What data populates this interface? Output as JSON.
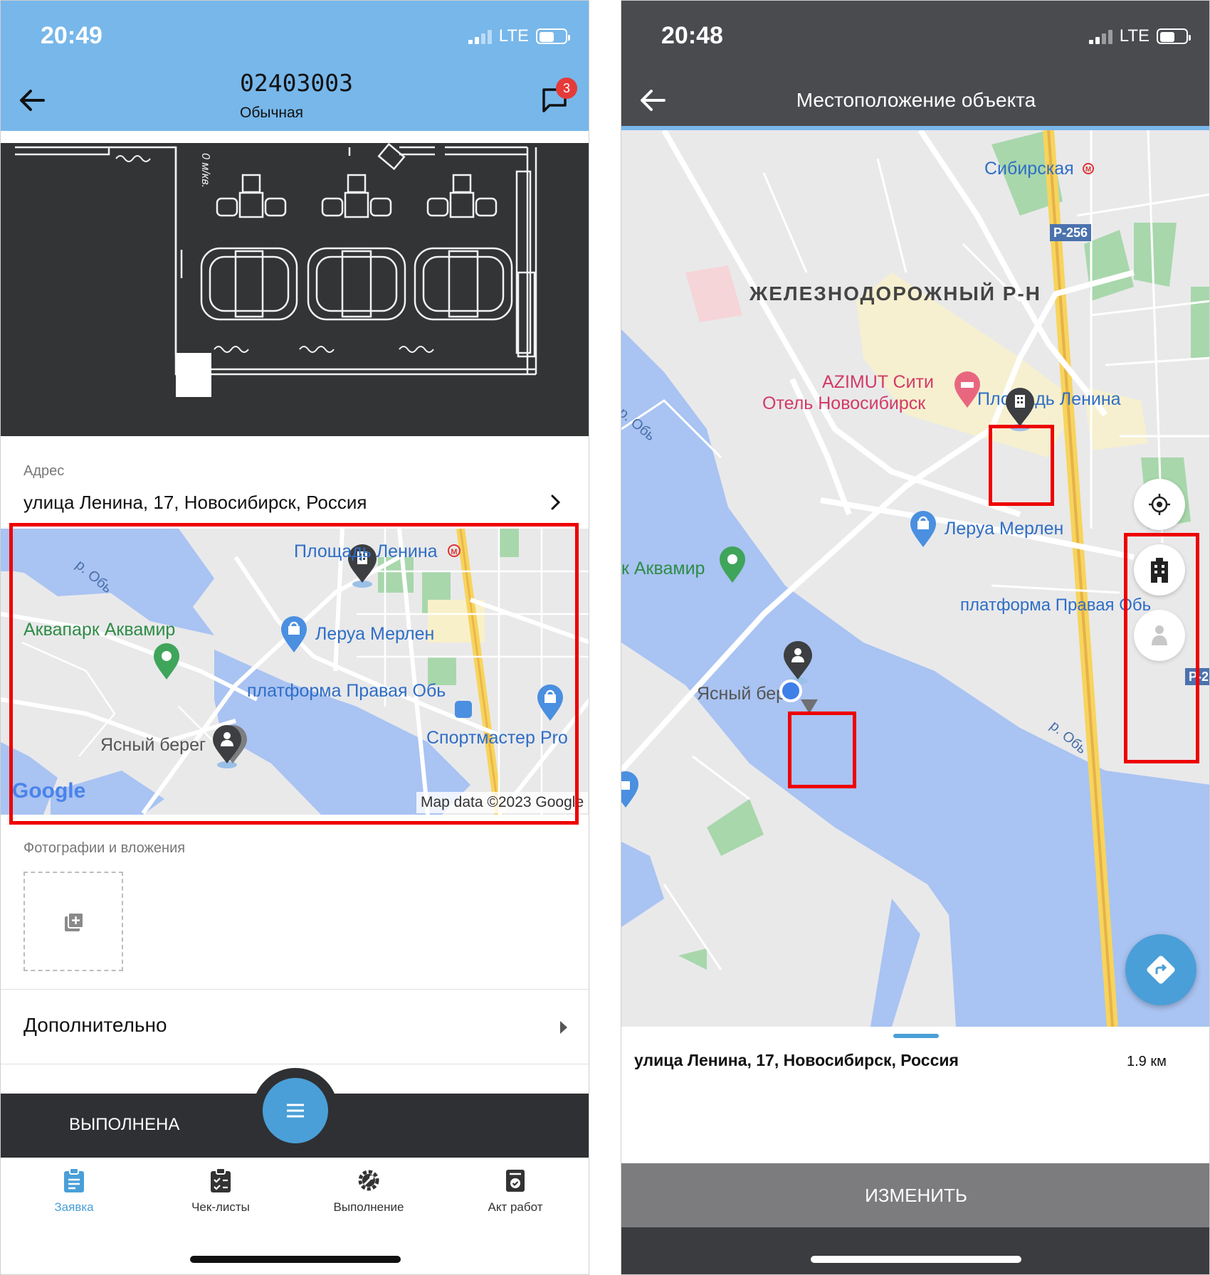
{
  "left": {
    "status": {
      "time": "20:49",
      "network": "LTE"
    },
    "header": {
      "title": "02403003",
      "subtitle": "Обычная",
      "chat_badge": "3",
      "color": "#77b7ea"
    },
    "address": {
      "label": "Адрес",
      "value": "улица Ленина, 17, Новосибирск, Россия"
    },
    "floorplan": {
      "note": "0 м/кв."
    },
    "map": {
      "labels": {
        "metro": "Площадь Ленина",
        "store": "Леруа Мерлен",
        "aquapark": "Аквапарк Аквамир",
        "platform": "платформа Правая Обь",
        "sport": "Спортмастер Pro",
        "district": "Ясный берег",
        "river": "р. Обь"
      },
      "brand": "Google",
      "attribution": "Map data ©2023 Google"
    },
    "attachments": {
      "label": "Фотографии и вложения"
    },
    "extra": {
      "label": "Дополнительно"
    },
    "status_bar": {
      "label": "ВЫПОЛНЕНА"
    },
    "tabs": [
      {
        "label": "Заявка",
        "icon": "clipboard-icon",
        "active": true
      },
      {
        "label": "Чек-листы",
        "icon": "checklist-icon",
        "active": false
      },
      {
        "label": "Выполнение",
        "icon": "gear-wrench-icon",
        "active": false
      },
      {
        "label": "Акт работ",
        "icon": "act-icon",
        "active": false
      }
    ]
  },
  "right": {
    "status": {
      "time": "20:48",
      "network": "LTE"
    },
    "header": {
      "title": "Местоположение объекта"
    },
    "map": {
      "labels": {
        "station": "Сибирская",
        "road1": "Р-256",
        "road2": "Р-2",
        "district": "ЖЕЛЕЗНОДОРОЖНЫЙ Р-Н",
        "hotel_line1": "AZIMUT Сити",
        "hotel_line2": "Отель Новосибирск",
        "metro": "Площадь Ленина",
        "store": "Леруа Мерлен",
        "aquapark": "к Аквамир",
        "platform": "платформа Правая Обь",
        "shore": "Ясный берег",
        "river_a": "р. Обь",
        "river_b": "р. Обь"
      }
    },
    "bottom_sheet": {
      "address": "улица Ленина, 17, Новосибирск, Россия",
      "distance": "1.9 км"
    },
    "action_button": {
      "label": "ИЗМЕНИТЬ"
    }
  },
  "colors": {
    "accent": "#4a9fd8",
    "dark": "#2f3033",
    "highlight": "#ee0000",
    "water": "#a9c3f2",
    "land": "#e9e9ea"
  }
}
